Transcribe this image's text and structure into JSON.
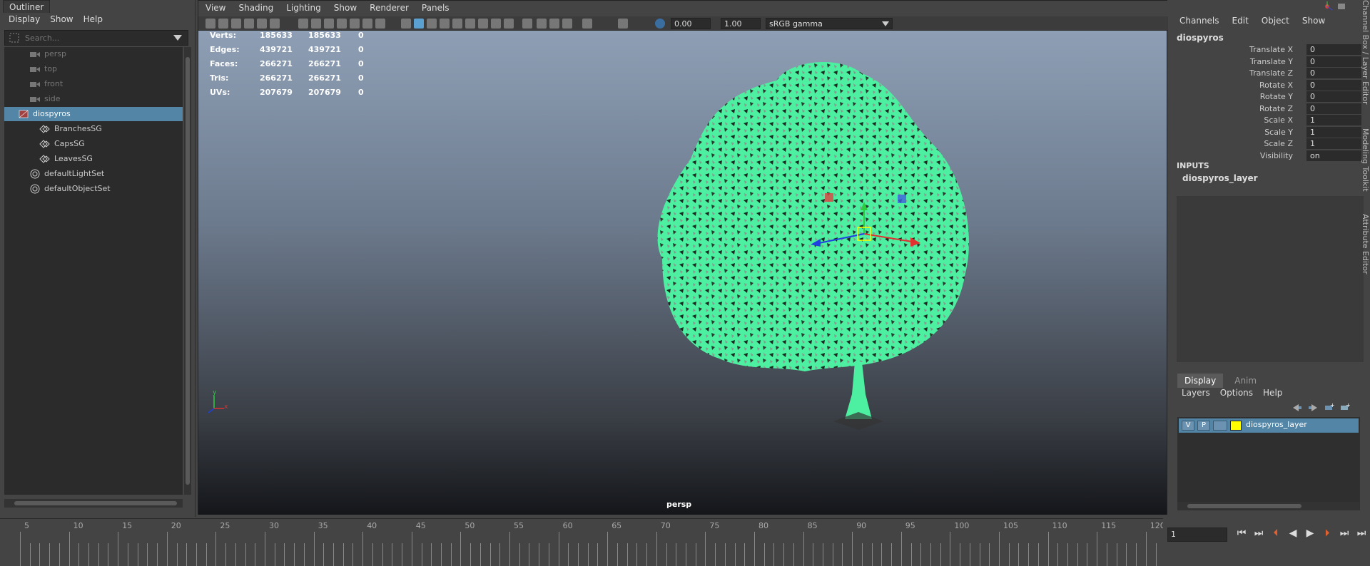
{
  "outliner": {
    "tab": "Outliner",
    "menu": [
      "Display",
      "Show",
      "Help"
    ],
    "search_placeholder": "Search...",
    "items": [
      {
        "label": "persp",
        "dim": true,
        "indent": 1,
        "icon": "camera-icon"
      },
      {
        "label": "top",
        "dim": true,
        "indent": 1,
        "icon": "camera-icon"
      },
      {
        "label": "front",
        "dim": true,
        "indent": 1,
        "icon": "camera-icon"
      },
      {
        "label": "side",
        "dim": true,
        "indent": 1,
        "icon": "camera-icon"
      },
      {
        "label": "diospyros",
        "selected": true,
        "indent": 0,
        "icon": "mesh-icon"
      },
      {
        "label": "BranchesSG",
        "indent": 2,
        "icon": "shading-group-icon"
      },
      {
        "label": "CapsSG",
        "indent": 2,
        "icon": "shading-group-icon"
      },
      {
        "label": "LeavesSG",
        "indent": 2,
        "icon": "shading-group-icon"
      },
      {
        "label": "defaultLightSet",
        "indent": 1,
        "icon": "set-icon"
      },
      {
        "label": "defaultObjectSet",
        "indent": 1,
        "icon": "set-icon"
      }
    ]
  },
  "viewport": {
    "menu": [
      "View",
      "Shading",
      "Lighting",
      "Show",
      "Renderer",
      "Panels"
    ],
    "exposure": "0.00",
    "gamma": "1.00",
    "color_space": "sRGB gamma",
    "camera_label": "persp",
    "hud": [
      {
        "label": "Verts:",
        "a": "185633",
        "b": "185633",
        "c": "0"
      },
      {
        "label": "Edges:",
        "a": "439721",
        "b": "439721",
        "c": "0"
      },
      {
        "label": "Faces:",
        "a": "266271",
        "b": "266271",
        "c": "0"
      },
      {
        "label": "Tris:",
        "a": "266271",
        "b": "266271",
        "c": "0"
      },
      {
        "label": "UVs:",
        "a": "207679",
        "b": "207679",
        "c": "0"
      }
    ],
    "axis": {
      "x": "x",
      "y": "y"
    }
  },
  "channel_box": {
    "menu": [
      "Channels",
      "Edit",
      "Object",
      "Show"
    ],
    "object_name": "diospyros",
    "attributes": [
      {
        "label": "Translate X",
        "value": "0"
      },
      {
        "label": "Translate Y",
        "value": "0"
      },
      {
        "label": "Translate Z",
        "value": "0"
      },
      {
        "label": "Rotate X",
        "value": "0"
      },
      {
        "label": "Rotate Y",
        "value": "0"
      },
      {
        "label": "Rotate Z",
        "value": "0"
      },
      {
        "label": "Scale X",
        "value": "1"
      },
      {
        "label": "Scale Y",
        "value": "1"
      },
      {
        "label": "Scale Z",
        "value": "1"
      },
      {
        "label": "Visibility",
        "value": "on"
      }
    ],
    "inputs_header": "INPUTS",
    "input_name": "diospyros_layer",
    "side_tabs": [
      "Channel Box / Layer Editor",
      "Modeling Toolkit",
      "Attribute Editor"
    ]
  },
  "layer_editor": {
    "tabs": [
      "Display",
      "Anim"
    ],
    "menu": [
      "Layers",
      "Options",
      "Help"
    ],
    "layer": {
      "v": "V",
      "p": "P",
      "name": "diospyros_layer",
      "color": "#ffff00"
    }
  },
  "timeline": {
    "ticks": [
      "5",
      "10",
      "15",
      "20",
      "25",
      "30",
      "35",
      "40",
      "45",
      "50",
      "55",
      "60",
      "65",
      "70",
      "75",
      "80",
      "85",
      "90",
      "95",
      "100",
      "105",
      "110",
      "115",
      "120"
    ],
    "current_frame": "1"
  },
  "colors": {
    "selection": "#5285a6",
    "tree_green": "#4df0a0",
    "layer_color": "#ffff00"
  }
}
